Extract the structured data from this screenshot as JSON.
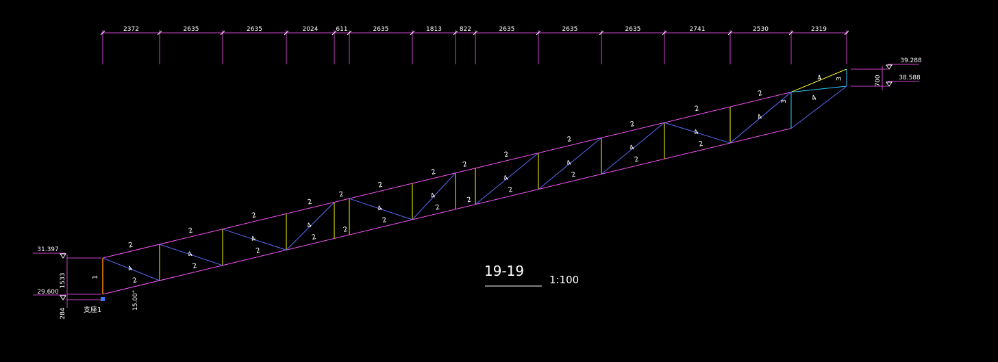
{
  "drawing": {
    "section_title": "19-19",
    "scale": "1:100",
    "support_label": "支座1",
    "angle_label": "15.00°"
  },
  "dimensions": {
    "top_segments": [
      "2372",
      "2635",
      "2635",
      "2024",
      "611",
      "2635",
      "1813",
      "822",
      "2635",
      "2635",
      "2635",
      "2741",
      "2530",
      "2319"
    ],
    "left_height": "1533",
    "left_offset": "284",
    "right_depth": "700"
  },
  "elevations": {
    "left_top": "31.397",
    "left_bottom": "29.600",
    "right_top": "39.288",
    "right_bottom": "38.588"
  },
  "truss": {
    "top_chord_labels": [
      "2",
      "2",
      "2",
      "2",
      "2",
      "2",
      "2",
      "2",
      "2",
      "2",
      "2",
      "2",
      "2"
    ],
    "bottom_chord_labels": [
      "2",
      "2",
      "2",
      "2",
      "2",
      "2",
      "2",
      "2",
      "2",
      "2",
      "2",
      "2"
    ],
    "diagonal_labels": [
      "4",
      "4",
      "4",
      "4",
      "4",
      "4",
      "4",
      "4",
      "4",
      "4",
      "4",
      "4"
    ],
    "end_post_label": "1",
    "end_member_label": "3",
    "end_top_label": "4",
    "end_diag_label": "4"
  },
  "colors": {
    "background": "#000000",
    "chord": "#ff55ff",
    "diagonal": "#5b6cff",
    "vertical": "#ffff00",
    "end_post": "#ff8800",
    "end_member": "#33ccff",
    "text": "#ffffff",
    "dim_line": "#cc44cc"
  }
}
